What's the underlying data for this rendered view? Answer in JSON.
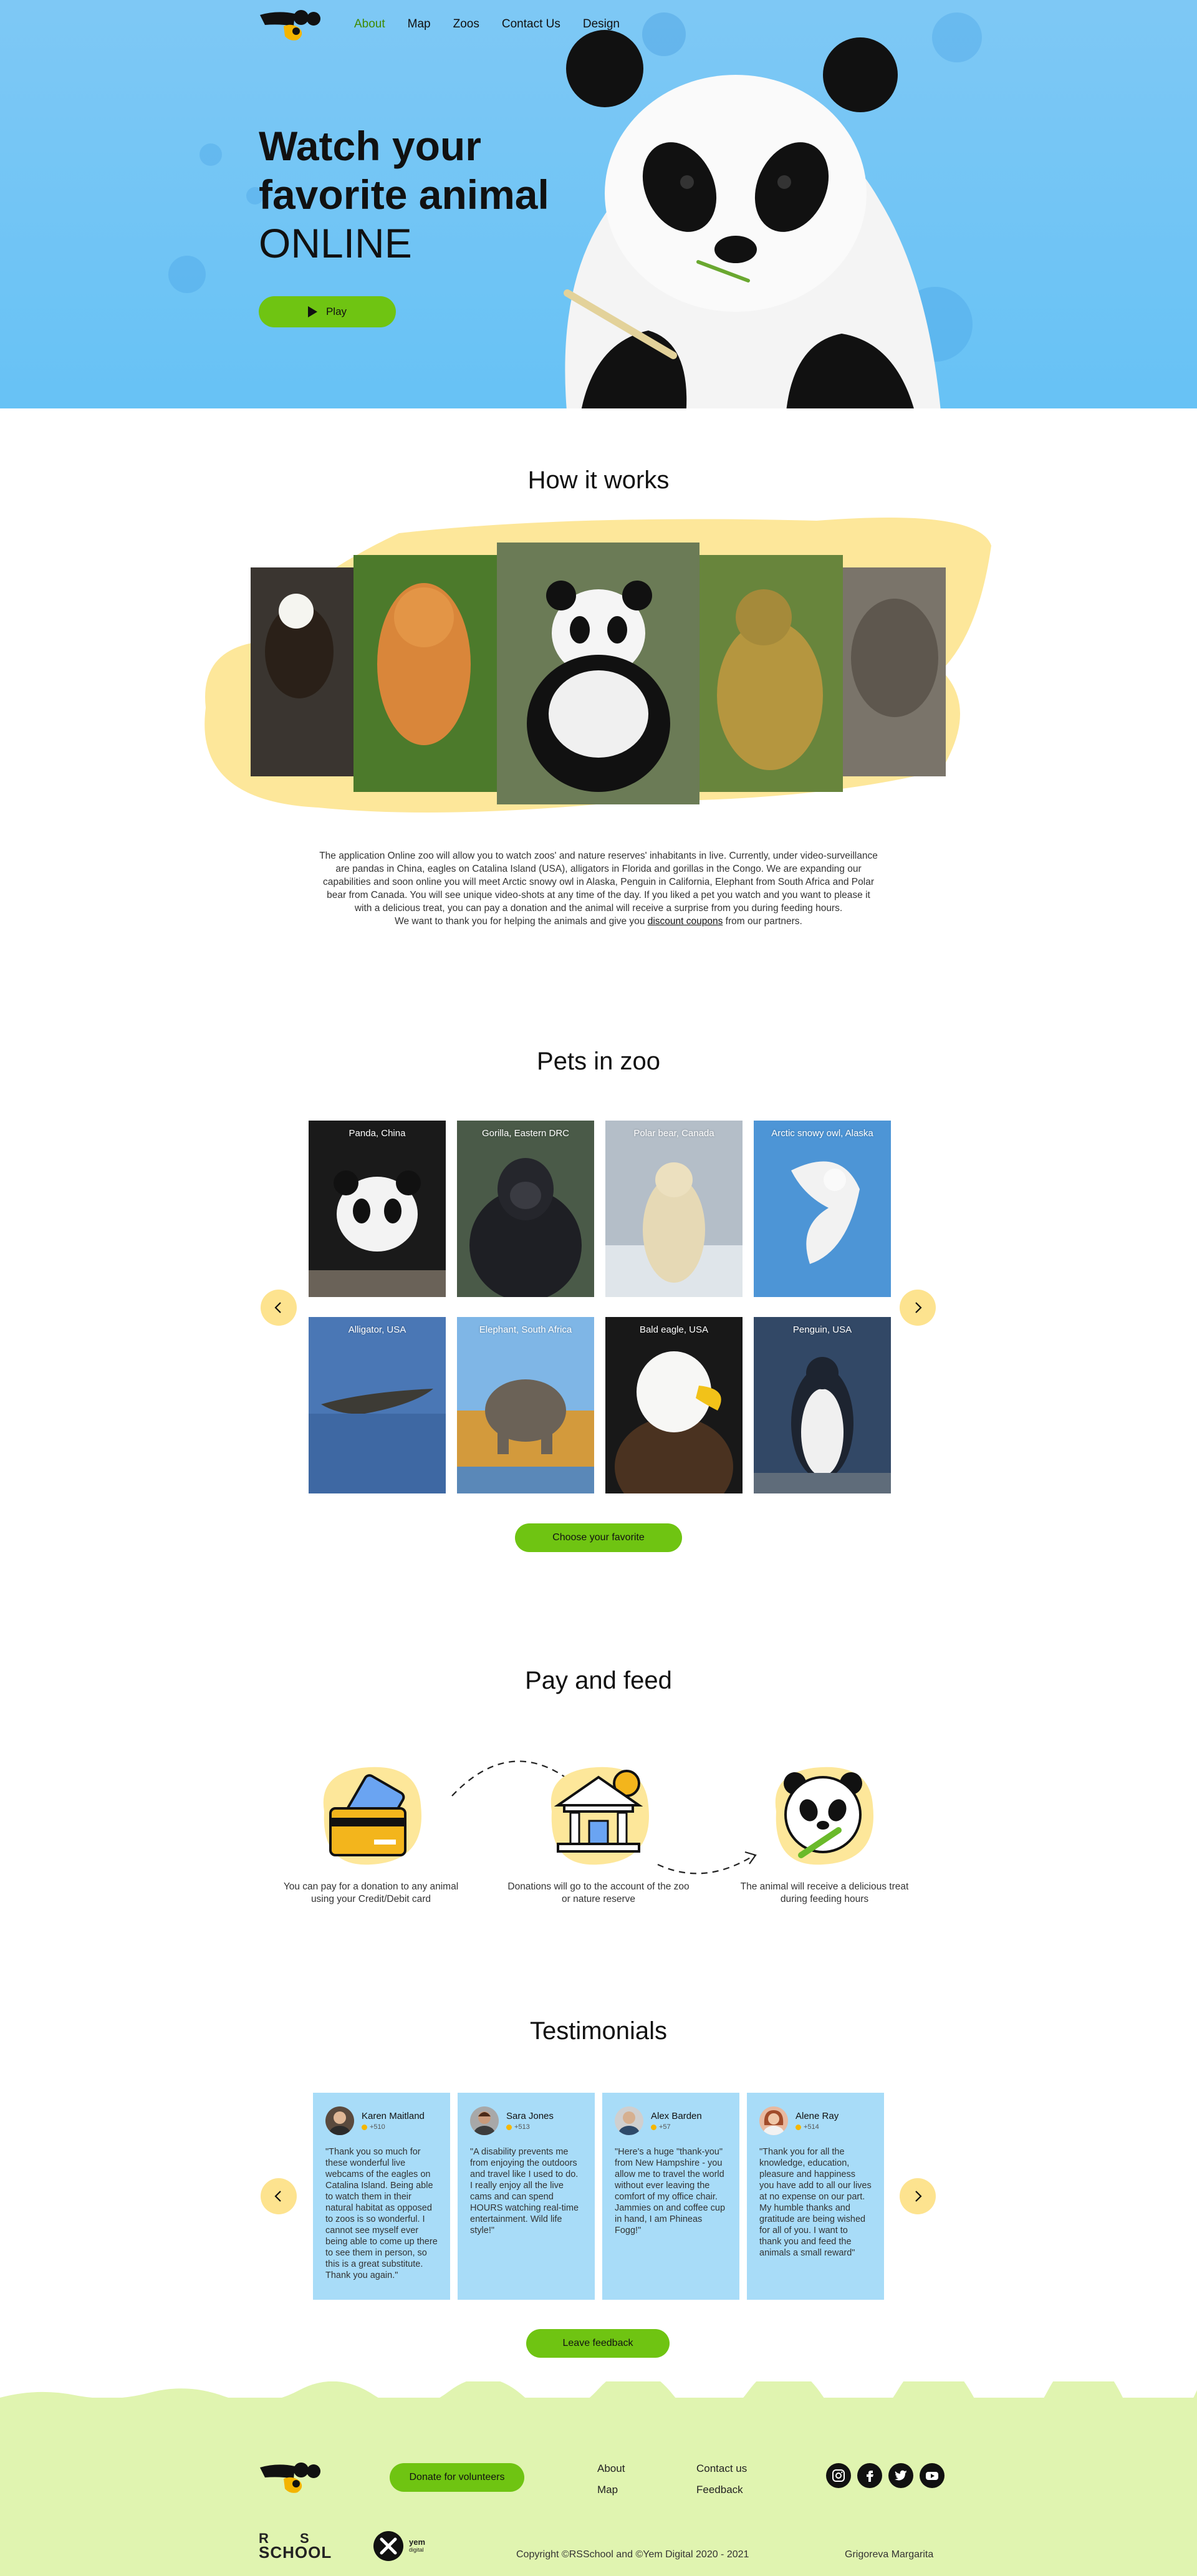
{
  "nav": {
    "items": [
      {
        "label": "About",
        "active": true
      },
      {
        "label": "Map",
        "active": false
      },
      {
        "label": "Zoos",
        "active": false
      },
      {
        "label": "Contact Us",
        "active": false
      },
      {
        "label": "Design",
        "active": false
      }
    ]
  },
  "hero": {
    "title_line1": "Watch your",
    "title_line2": "favorite animal",
    "title_line3": "ONLINE",
    "play_label": "Play"
  },
  "how": {
    "title": "How it works",
    "desc_main": "The application Online zoo will allow you to watch zoos' and nature reserves' inhabitants in live. Currently, under video-surveillance are pandas in China, eagles on Catalina Island (USA), alligators in Florida and gorillas in the Congo. We are expanding our capabilities and soon online you will meet Arctic snowy owl in Alaska, Penguin in California, Elephant from South Africa and Polar bear from Canada. You will see unique video-shots at any time of the day. If you liked a pet you watch and you want to please it with a delicious treat, you can pay a donation and the animal will receive a surprise from you during feeding hours.",
    "desc_thanks_prefix": "We want to thank you for helping the animals and give you",
    "desc_link": "discount coupons",
    "desc_thanks_suffix": "from our partners."
  },
  "pets": {
    "title": "Pets in zoo",
    "cards": [
      {
        "label": "Panda, China"
      },
      {
        "label": "Gorilla, Eastern DRC"
      },
      {
        "label": "Polar bear, Canada"
      },
      {
        "label": "Arctic snowy owl, Alaska"
      },
      {
        "label": "Alligator, USA"
      },
      {
        "label": "Elephant, South Africa"
      },
      {
        "label": "Bald eagle, USA"
      },
      {
        "label": "Penguin, USA"
      }
    ],
    "choose_label": "Choose your favorite"
  },
  "pay": {
    "title": "Pay and feed",
    "steps": [
      {
        "text_line1": "You can pay for a donation to any animal",
        "text_line2": "using your Credit/Debit card"
      },
      {
        "text_line1": "Donations will go to the account of the zoo",
        "text_line2": "or nature reserve"
      },
      {
        "text_line1": "The animal will receive a delicious treat",
        "text_line2": "during feeding hours"
      }
    ]
  },
  "testimonials": {
    "title": "Testimonials",
    "items": [
      {
        "name": "Karen Maitland",
        "stars": "+510",
        "text": "\"Thank you so much for these wonderful live webcams of the eagles on Catalina Island. Being able to watch them in their natural habitat as opposed to zoos is so wonderful. I cannot see myself ever being able to come up there to see them in person, so this is a great substitute. Thank you again.\""
      },
      {
        "name": "Sara Jones",
        "stars": "+513",
        "text": "\"A disability prevents me from enjoying the outdoors and travel like I used to do. I really enjoy all the live cams and can spend HOURS watching real-time entertainment. Wild life style!\""
      },
      {
        "name": "Alex Barden",
        "stars": "+57",
        "text": "\"Here's a huge \"thank-you\" from New Hampshire - you allow me to travel the world without ever leaving the comfort of my office chair. Jammies on and coffee cup in hand, I am Phineas Fogg!\""
      },
      {
        "name": "Alene Ray",
        "stars": "+514",
        "text": "\"Thank you for all the knowledge, education, pleasure and happiness you have add to all our lives at no expense on our part. My humble thanks and gratitude are being wished for all of you. I want to thank you and feed the animals a small reward\""
      }
    ],
    "leave_label": "Leave feedback"
  },
  "footer": {
    "donate_label": "Donate for volunteers",
    "links": [
      "About",
      "Map",
      "Contact us",
      "Feedback"
    ],
    "rs_logo_line1": "R S",
    "rs_logo_line2": "SCHOOL",
    "yem_logo_line1": "yem",
    "yem_logo_line2": "digital",
    "copyright": "Copyright ©RSSchool and ©Yem Digital 2020 - 2021",
    "author": "Grigoreva Margarita"
  },
  "colors": {
    "hero_bg": "#6ec3f5",
    "accent_green": "#6fc412",
    "arrow_yellow": "#fde38f",
    "testimonial_card": "#a8dcf8",
    "footer_bg": "#e0f4b0",
    "active_nav": "#3f8a00"
  },
  "icons": {
    "play": "play-icon",
    "prev": "chevron-left-icon",
    "next": "chevron-right-icon",
    "socials": [
      "instagram-icon",
      "facebook-icon",
      "twitter-icon",
      "youtube-icon"
    ]
  }
}
